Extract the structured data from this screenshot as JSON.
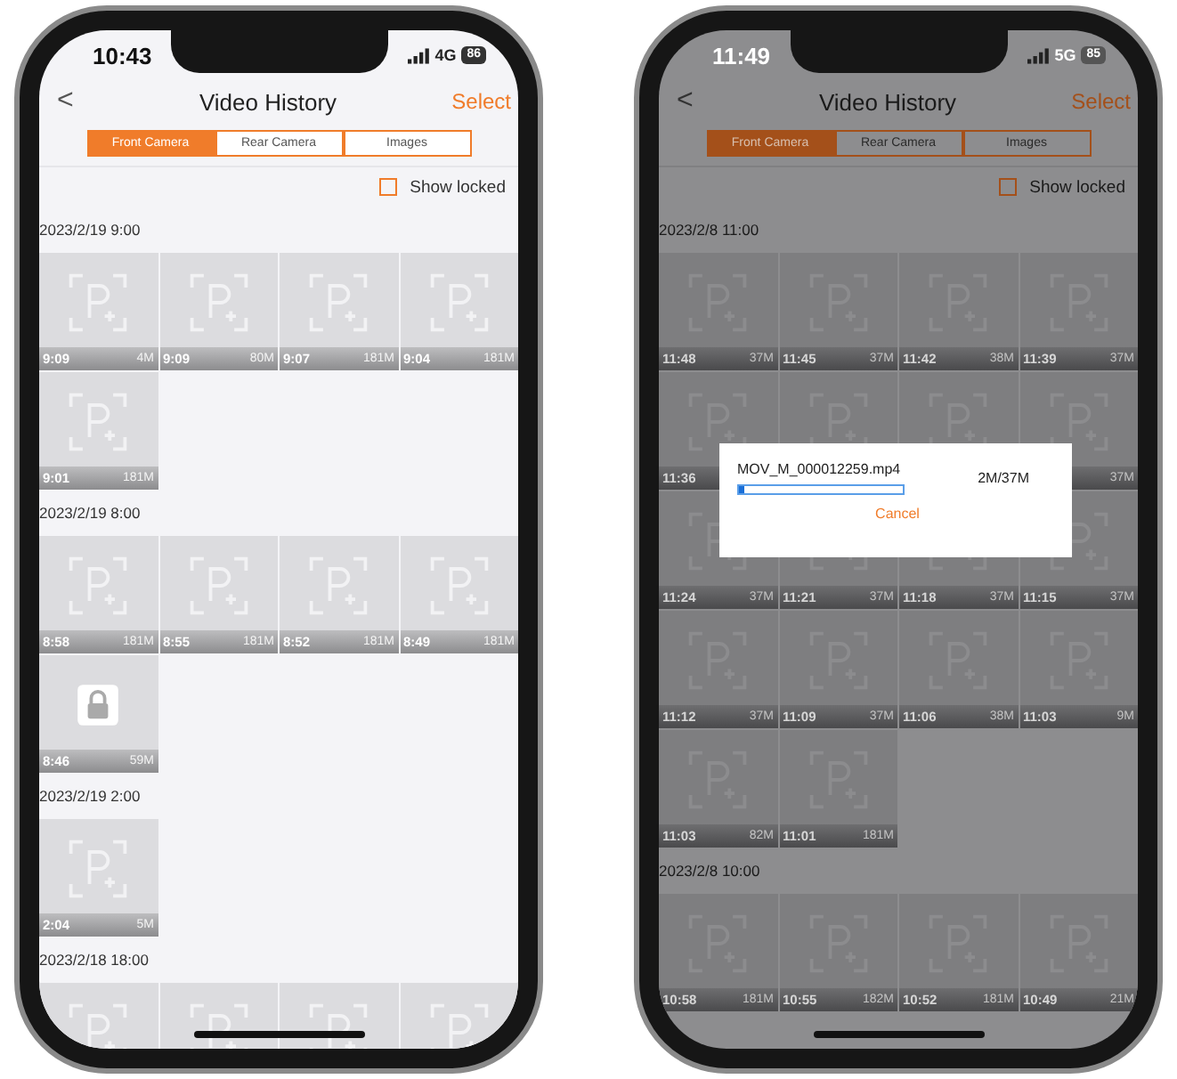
{
  "phones": [
    {
      "status": {
        "time": "10:43",
        "network": "4G",
        "battery": "86"
      },
      "title": "Video History",
      "back": "<",
      "action": "Select",
      "tabs": [
        {
          "label": "Front Camera",
          "selected": true
        },
        {
          "label": "Rear Camera",
          "selected": false
        },
        {
          "label": "Images",
          "selected": false
        }
      ],
      "show_locked": {
        "label": "Show locked",
        "checked": false
      },
      "groups": [
        {
          "date": "2023/2/19 9:00",
          "clips": [
            {
              "time": "9:09",
              "size": "4M",
              "locked": false
            },
            {
              "time": "9:09",
              "size": "80M",
              "locked": false
            },
            {
              "time": "9:07",
              "size": "181M",
              "locked": false
            },
            {
              "time": "9:04",
              "size": "181M",
              "locked": false
            },
            {
              "time": "9:01",
              "size": "181M",
              "locked": false
            }
          ]
        },
        {
          "date": "2023/2/19 8:00",
          "clips": [
            {
              "time": "8:58",
              "size": "181M",
              "locked": false
            },
            {
              "time": "8:55",
              "size": "181M",
              "locked": false
            },
            {
              "time": "8:52",
              "size": "181M",
              "locked": false
            },
            {
              "time": "8:49",
              "size": "181M",
              "locked": false
            },
            {
              "time": "8:46",
              "size": "59M",
              "locked": true
            }
          ]
        },
        {
          "date": "2023/2/19 2:00",
          "clips": [
            {
              "time": "2:04",
              "size": "5M",
              "locked": false
            }
          ]
        },
        {
          "date": "2023/2/18 18:00",
          "clips": [
            {
              "locked": false
            },
            {
              "locked": false
            },
            {
              "locked": false
            },
            {
              "locked": false
            }
          ]
        }
      ]
    },
    {
      "status": {
        "time": "11:49",
        "network": "5G",
        "battery": "85"
      },
      "title": "Video History",
      "back": "<",
      "action": "Select",
      "tabs": [
        {
          "label": "Front Camera",
          "selected": true
        },
        {
          "label": "Rear Camera",
          "selected": false
        },
        {
          "label": "Images",
          "selected": false
        }
      ],
      "show_locked": {
        "label": "Show locked",
        "checked": false
      },
      "groups": [
        {
          "date": "2023/2/8 11:00",
          "clips": [
            {
              "time": "11:48",
              "size": "37M",
              "locked": false
            },
            {
              "time": "11:45",
              "size": "37M",
              "locked": false
            },
            {
              "time": "11:42",
              "size": "38M",
              "locked": false
            },
            {
              "time": "11:39",
              "size": "37M",
              "locked": false
            },
            {
              "time": "11:36",
              "locked": false
            },
            {
              "locked": false
            },
            {
              "locked": false
            },
            {
              "size": "37M",
              "locked": false
            },
            {
              "time": "11:24",
              "size": "37M",
              "locked": false
            },
            {
              "time": "11:21",
              "size": "37M",
              "locked": false
            },
            {
              "time": "11:18",
              "size": "37M",
              "locked": false
            },
            {
              "time": "11:15",
              "size": "37M",
              "locked": false
            },
            {
              "time": "11:12",
              "size": "37M",
              "locked": false
            },
            {
              "time": "11:09",
              "size": "37M",
              "locked": false
            },
            {
              "time": "11:06",
              "size": "38M",
              "locked": false
            },
            {
              "time": "11:03",
              "size": "9M",
              "locked": false
            },
            {
              "time": "11:03",
              "size": "82M",
              "locked": false
            },
            {
              "time": "11:01",
              "size": "181M",
              "locked": false
            }
          ]
        },
        {
          "date": "2023/2/8 10:00",
          "clips": [
            {
              "time": "10:58",
              "size": "181M",
              "locked": false
            },
            {
              "time": "10:55",
              "size": "182M",
              "locked": false
            },
            {
              "time": "10:52",
              "size": "181M",
              "locked": false
            },
            {
              "time": "10:49",
              "size": "21M",
              "locked": false
            }
          ]
        }
      ],
      "dialog": {
        "file_name": "MOV_M_000012259.mp4",
        "level": 0.03,
        "progress": "2M/37M",
        "cancel": "Cancel"
      }
    }
  ]
}
